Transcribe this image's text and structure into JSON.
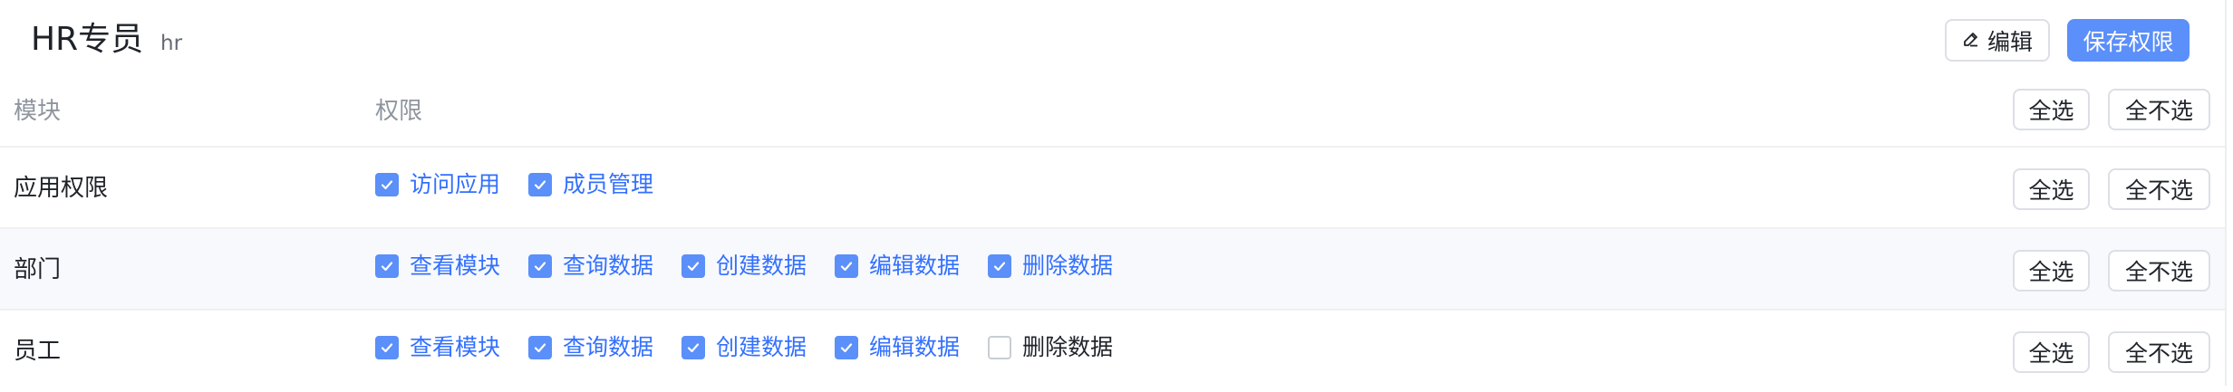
{
  "role": {
    "title": "HR专员",
    "code": "hr"
  },
  "header_actions": {
    "edit_label": "编辑",
    "save_label": "保存权限"
  },
  "table": {
    "col_module": "模块",
    "col_permission": "权限",
    "select_all_label": "全选",
    "select_none_label": "全不选",
    "rows": [
      {
        "module": "应用权限",
        "perms": [
          {
            "label": "访问应用",
            "checked": true
          },
          {
            "label": "成员管理",
            "checked": true
          }
        ]
      },
      {
        "module": "部门",
        "perms": [
          {
            "label": "查看模块",
            "checked": true
          },
          {
            "label": "查询数据",
            "checked": true
          },
          {
            "label": "创建数据",
            "checked": true
          },
          {
            "label": "编辑数据",
            "checked": true
          },
          {
            "label": "删除数据",
            "checked": true
          }
        ]
      },
      {
        "module": "员工",
        "perms": [
          {
            "label": "查看模块",
            "checked": true
          },
          {
            "label": "查询数据",
            "checked": true
          },
          {
            "label": "创建数据",
            "checked": true
          },
          {
            "label": "编辑数据",
            "checked": true
          },
          {
            "label": "删除数据",
            "checked": false
          }
        ]
      }
    ]
  },
  "colors": {
    "primary": "#5b8ff9",
    "link": "#3370ff",
    "row_alt_bg": "#f7f9fc"
  },
  "icons": {
    "edit": "edit-pen-icon",
    "check": "check-icon"
  }
}
